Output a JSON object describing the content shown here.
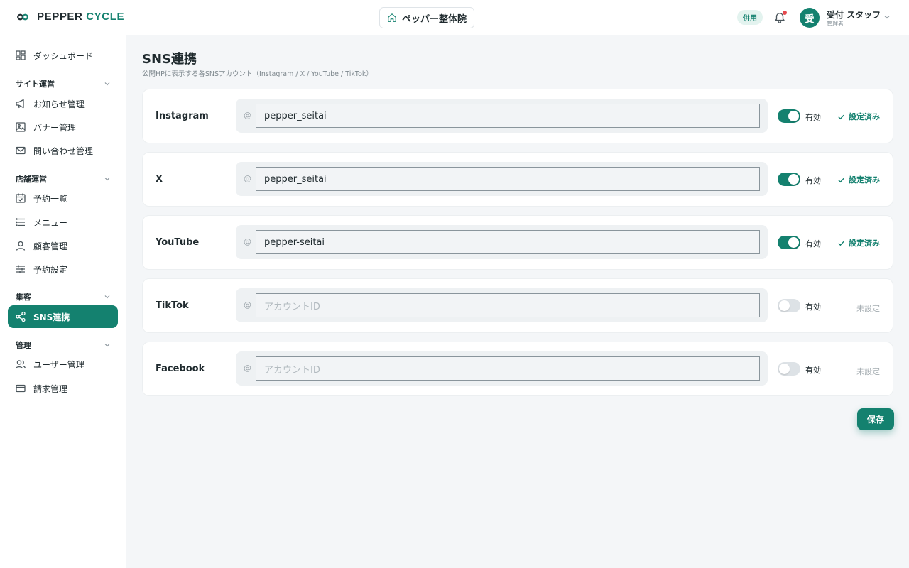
{
  "brand": {
    "name_part1": "PEPPER ",
    "name_part2": "CYCLE",
    "accent": "#14816f"
  },
  "header": {
    "shop_name": "ペッパー整体院",
    "badge": "併用",
    "user": {
      "avatar_initial": "受",
      "name": "受付 スタッフ",
      "role": "管理者"
    }
  },
  "sidebar": {
    "dashboard": "ダッシュボード",
    "sections": {
      "site": "サイト運営",
      "store": "店舗運営",
      "marketing": "集客",
      "admin": "管理"
    },
    "items": {
      "news": "お知らせ管理",
      "banner": "バナー管理",
      "inquiry": "問い合わせ管理",
      "reservations": "予約一覧",
      "menu": "メニュー",
      "customers": "顧客管理",
      "reservation_settings": "予約設定",
      "sns": "SNS連携",
      "users": "ユーザー管理",
      "billing": "請求管理"
    }
  },
  "main": {
    "title": "SNS連携",
    "subtitle": "公開HPに表示する各SNSアカウント（Instagram / X / YouTube / TikTok）",
    "at_symbol": "@",
    "toggle_label": "有効",
    "placeholder": "アカウントID",
    "status_set": "設定済み",
    "status_unset": "未設定",
    "accounts": [
      {
        "name": "Instagram",
        "value": "pepper_seitai",
        "enabled": true
      },
      {
        "name": "X",
        "value": "pepper_seitai",
        "enabled": true
      },
      {
        "name": "YouTube",
        "value": "pepper-seitai",
        "enabled": true
      },
      {
        "name": "TikTok",
        "value": "",
        "enabled": false
      },
      {
        "name": "Facebook",
        "value": "",
        "enabled": false
      }
    ],
    "save_label": "保存"
  }
}
